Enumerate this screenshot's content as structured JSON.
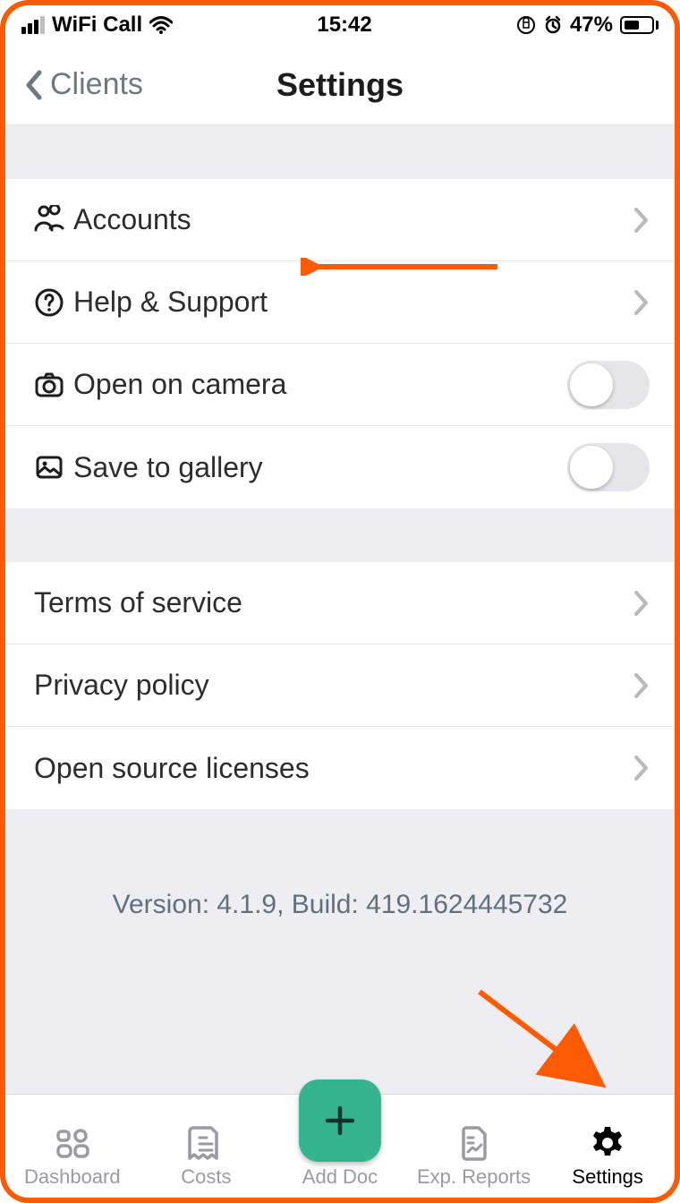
{
  "status": {
    "carrier": "WiFi Call",
    "time": "15:42",
    "battery_pct": "47%"
  },
  "nav": {
    "back_label": "Clients",
    "title": "Settings"
  },
  "section1": {
    "accounts": "Accounts",
    "help": "Help & Support",
    "open_camera": "Open on camera",
    "save_gallery": "Save to gallery",
    "open_camera_on": false,
    "save_gallery_on": false
  },
  "section2": {
    "terms": "Terms of service",
    "privacy": "Privacy policy",
    "oss": "Open source licenses"
  },
  "version_line": "Version: 4.1.9, Build: 419.1624445732",
  "tabs": {
    "dashboard": "Dashboard",
    "costs": "Costs",
    "add_doc": "Add Doc",
    "exp_reports": "Exp. Reports",
    "settings": "Settings"
  }
}
